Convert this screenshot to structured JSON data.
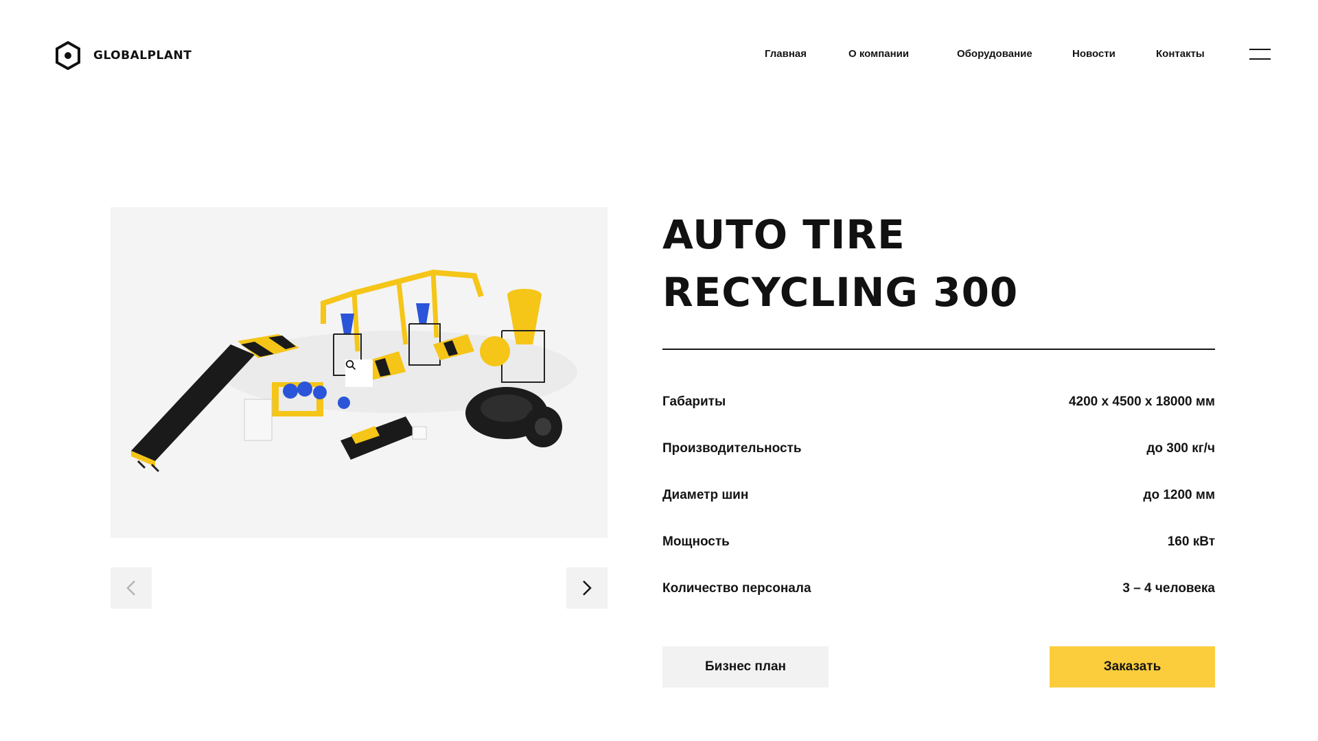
{
  "header": {
    "logo_text": "GLOBALPLANT",
    "nav": [
      "Главная",
      "О компании",
      "Оборудование",
      "Новости",
      "Контакты"
    ],
    "menu_icon": "hamburger-menu-icon"
  },
  "product": {
    "title_line1": "AUTO TIRE",
    "title_line2": "RECYCLING 300",
    "specs": [
      {
        "label": "Габариты",
        "value": "4200 x 4500 x 18000 мм"
      },
      {
        "label": "Производительность",
        "value": "до 300 кг/ч"
      },
      {
        "label": "Диаметр шин",
        "value": "до 1200 мм"
      },
      {
        "label": "Мощность",
        "value": "160 кВт"
      },
      {
        "label": "Количество персонала",
        "value": "3 – 4 человека"
      }
    ],
    "buttons": {
      "plan": "Бизнес план",
      "order": "Заказать"
    }
  },
  "gallery": {
    "zoom_icon": "magnifier-icon",
    "prev_icon": "chevron-left-icon",
    "next_icon": "chevron-right-icon"
  },
  "colors": {
    "accent": "#fbcd3d",
    "text": "#141414",
    "panel": "#f2f2f2"
  }
}
